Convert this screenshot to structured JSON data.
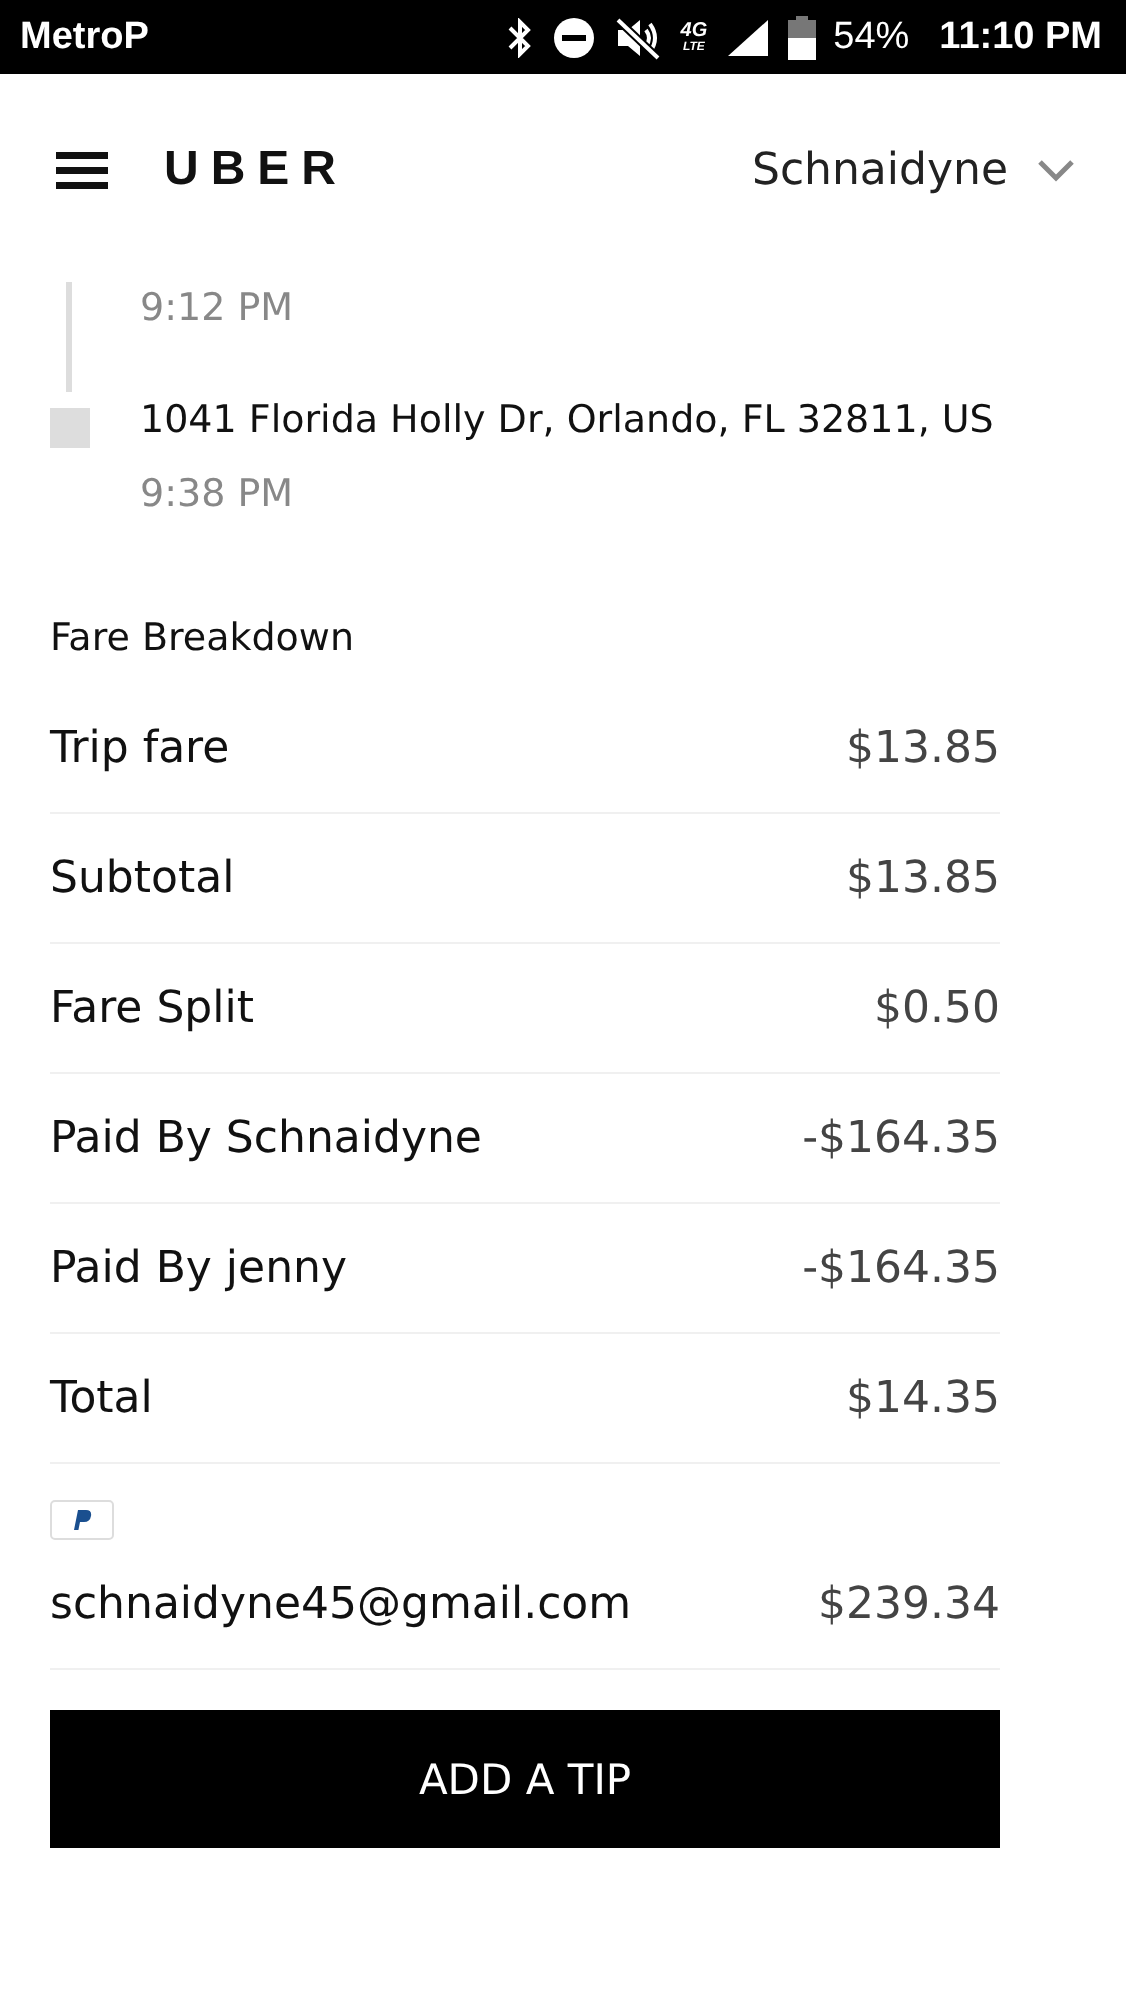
{
  "status_bar": {
    "carrier": "MetroP",
    "network": "4G",
    "network_sub": "LTE",
    "battery": "54%",
    "time": "11:10 PM"
  },
  "header": {
    "logo": "UBER",
    "account": "Schnaidyne"
  },
  "trip": {
    "start_time": "9:12 PM",
    "dropoff_address": "1041 Florida Holly Dr, Orlando, FL 32811, US",
    "dropoff_time": "9:38 PM"
  },
  "fare": {
    "title": "Fare Breakdown",
    "rows": [
      {
        "label": "Trip fare",
        "amount": "$13.85"
      },
      {
        "label": "Subtotal",
        "amount": "$13.85"
      },
      {
        "label": "Fare Split",
        "amount": "$0.50"
      },
      {
        "label": "Paid By Schnaidyne",
        "amount": "-$164.35"
      },
      {
        "label": "Paid By jenny",
        "amount": "-$164.35"
      },
      {
        "label": "Total",
        "amount": "$14.35"
      }
    ]
  },
  "payment": {
    "account": "schnaidyne45@gmail.com",
    "amount": "$239.34"
  },
  "tip_button": "ADD A TIP"
}
